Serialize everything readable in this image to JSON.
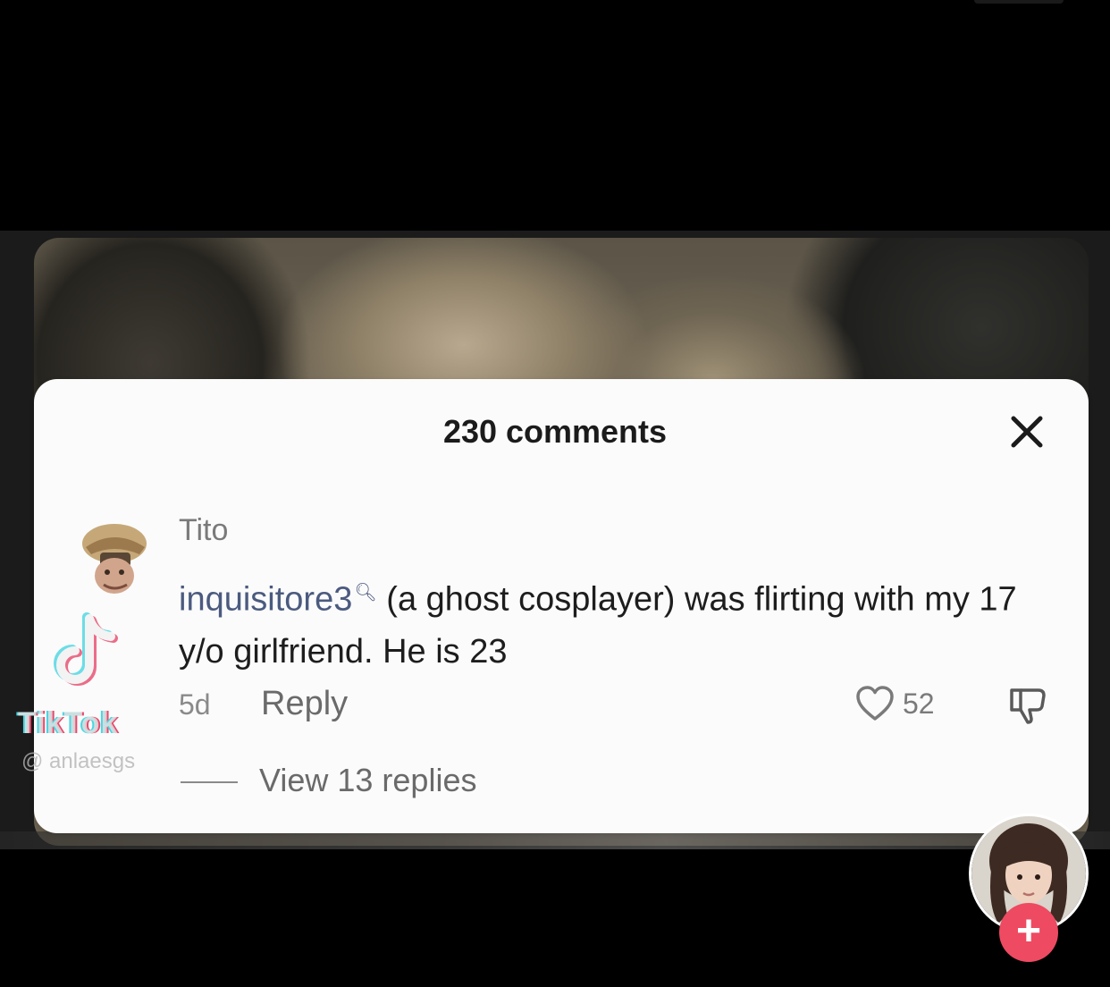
{
  "comments_panel": {
    "title": "230 comments"
  },
  "comment": {
    "username": "Tito",
    "mention": "inquisitore3",
    "body": " (a ghost cosplayer) was flirting with my 17 y/o girlfriend. He is 23",
    "time": "5d",
    "reply_label": "Reply",
    "like_count": "52",
    "view_replies_label": "View 13 replies"
  },
  "watermark": {
    "brand": "TikTok",
    "handle": "@ anlaesgs"
  },
  "icons": {
    "close": "close-icon",
    "heart": "heart-icon",
    "dislike": "thumbs-down-icon",
    "follow": "plus-icon"
  },
  "colors": {
    "mention": "#4b5a7f",
    "follow_button": "#ee4a62",
    "tiktok_cyan": "#49d6e2",
    "tiktok_red": "#e64a6d"
  }
}
